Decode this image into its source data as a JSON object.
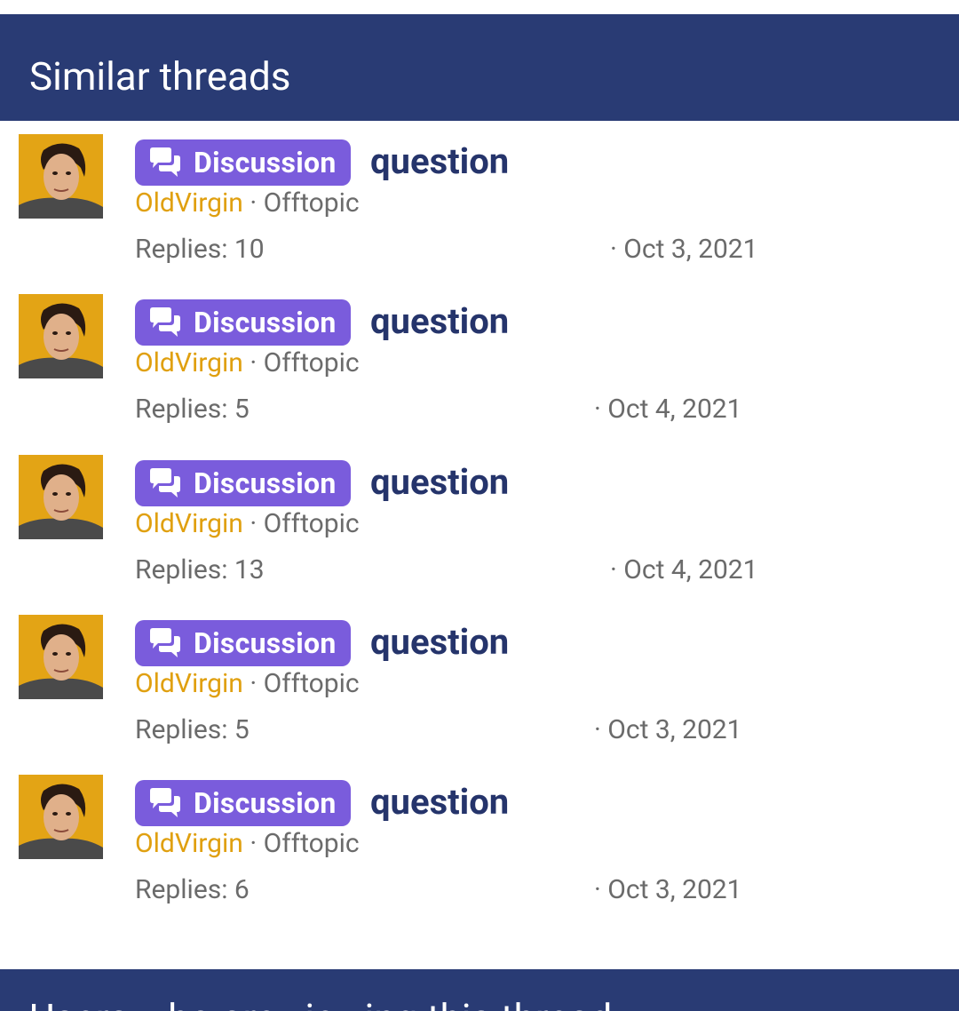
{
  "section": {
    "title": "Similar threads"
  },
  "threads": [
    {
      "prefix": "Discussion",
      "title": "question",
      "author": "OldVirgin",
      "separator": "·",
      "forum": "Offtopic",
      "replies": "Replies: 10",
      "date": "· Oct 3, 2021"
    },
    {
      "prefix": "Discussion",
      "title": "question",
      "author": "OldVirgin",
      "separator": "·",
      "forum": "Offtopic",
      "replies": "Replies: 5",
      "date": "· Oct 4, 2021"
    },
    {
      "prefix": "Discussion",
      "title": "question",
      "author": "OldVirgin",
      "separator": "·",
      "forum": "Offtopic",
      "replies": "Replies: 13",
      "date": "· Oct 4, 2021"
    },
    {
      "prefix": "Discussion",
      "title": "question",
      "author": "OldVirgin",
      "separator": "·",
      "forum": "Offtopic",
      "replies": "Replies: 5",
      "date": "· Oct 3, 2021"
    },
    {
      "prefix": "Discussion",
      "title": "question",
      "author": "OldVirgin",
      "separator": "·",
      "forum": "Offtopic",
      "replies": "Replies: 6",
      "date": "· Oct 3, 2021"
    }
  ],
  "footer": {
    "partial_text": "Users who are viewing this thread"
  },
  "icons": {
    "prefix_icon": "comments-icon",
    "avatar": "user-avatar"
  },
  "colors": {
    "header_bg": "#293b74",
    "badge_bg": "#7a5cdc",
    "title": "#25346b",
    "author": "#e0a010",
    "muted": "#6b6b6b"
  }
}
